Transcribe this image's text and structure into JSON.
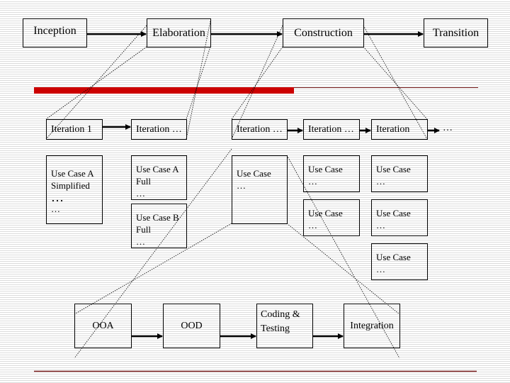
{
  "phases": [
    "Inception",
    "Elaboration",
    "Construction",
    "Transition"
  ],
  "iterations": [
    "Iteration 1",
    "Iteration …",
    "Iteration …",
    "Iteration …",
    "Iteration",
    "…"
  ],
  "use_cases": {
    "col1": {
      "line1": "Use Case A",
      "line2": "Simplified",
      "line3": "…",
      "line4": "…"
    },
    "col2a": {
      "line1": "Use Case A",
      "line2": "Full",
      "line3": "…"
    },
    "col2b": {
      "line1": "Use Case B",
      "line2": "Full",
      "line3": "…"
    },
    "col3": {
      "line1": "Use Case",
      "line2": "…"
    },
    "col4": [
      {
        "line1": "Use Case",
        "line2": "…"
      },
      {
        "line1": "Use Case",
        "line2": "…"
      }
    ],
    "col5": [
      {
        "line1": "Use Case",
        "line2": "…"
      },
      {
        "line1": "Use Case",
        "line2": "…"
      },
      {
        "line1": "Use Case",
        "line2": "…"
      }
    ]
  },
  "activities": {
    "ooa": "OOA",
    "ood": "OOD",
    "coding_line1": "Coding &",
    "coding_line2": "Testing",
    "integration": "Integration"
  },
  "colors": {
    "accent_bar": "#cc0000",
    "rule": "#7a1f1f"
  }
}
